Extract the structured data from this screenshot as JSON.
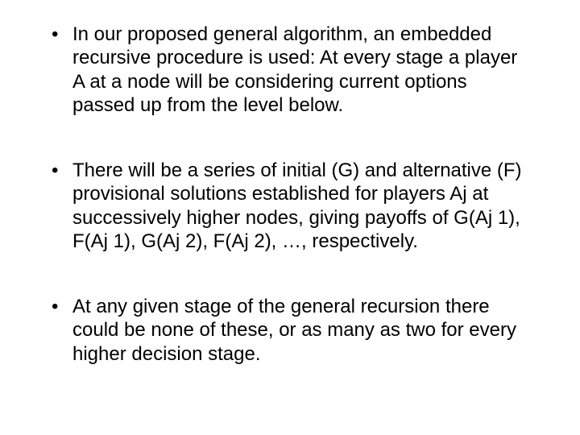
{
  "bullets": [
    "In our proposed general algorithm, an embedded recursive procedure is used: At every stage a player A at a node will be considering current options passed up from the level below.",
    "There will be a series of initial (G) and alternative (F) provisional solutions established for players Aj at successively higher nodes, giving payoffs of G(Aj 1), F(Aj 1), G(Aj 2), F(Aj 2), …, respectively.",
    "At any given stage of the general recursion there could be none of these, or as many as two for every higher decision stage."
  ]
}
